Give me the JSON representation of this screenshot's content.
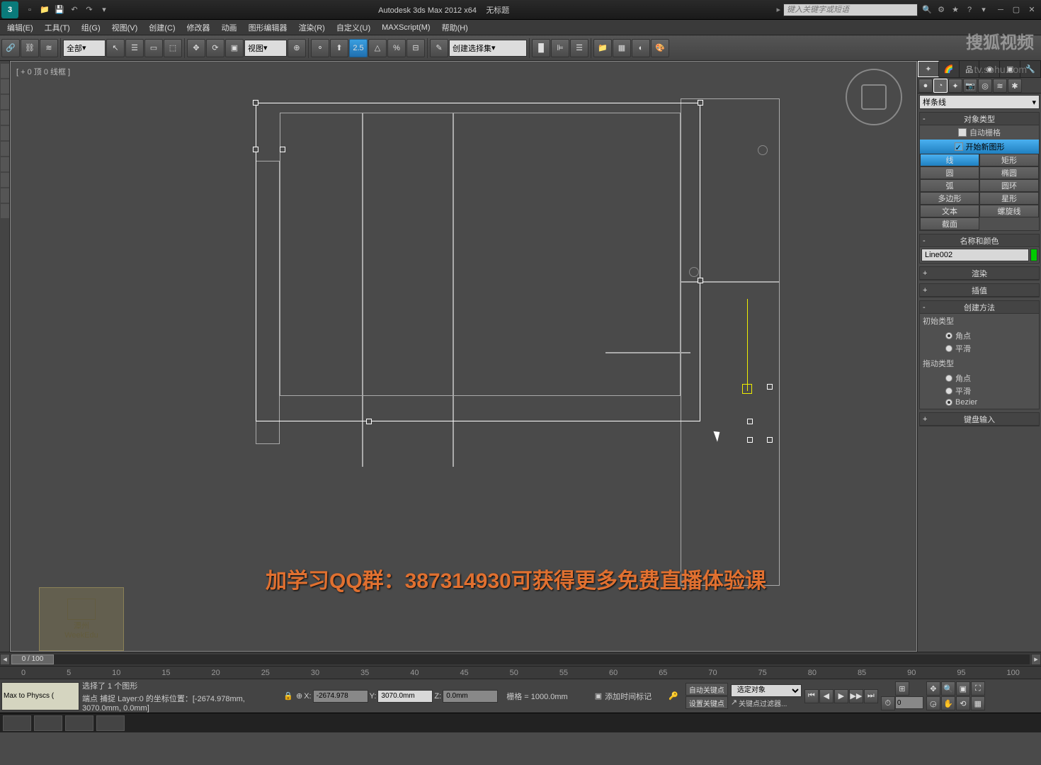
{
  "title": "Autodesk 3ds Max  2012 x64",
  "doc": "无标题",
  "search_placeholder": "键入关键字或短语",
  "menus": [
    "编辑(E)",
    "工具(T)",
    "组(G)",
    "视图(V)",
    "创建(C)",
    "修改器",
    "动画",
    "图形编辑器",
    "渲染(R)",
    "自定义(U)",
    "MAXScript(M)",
    "帮助(H)"
  ],
  "selset_drop": "创建选择集",
  "filter_drop": "全部",
  "view_drop": "视图",
  "snap_val": "2.5",
  "vp_label": "[ + 0 顶 0 线框 ]",
  "promo": "加学习QQ群：387314930可获得更多免费直播体验课",
  "shapes_drop": "样条线",
  "panel": {
    "obj_type": "对象类型",
    "autogrid": "自动栅格",
    "start_new": "开始新图形",
    "btns": [
      [
        "线",
        "矩形"
      ],
      [
        "圆",
        "椭圆"
      ],
      [
        "弧",
        "圆环"
      ],
      [
        "多边形",
        "星形"
      ],
      [
        "文本",
        "螺旋线"
      ],
      [
        "截面",
        ""
      ]
    ],
    "name_color": "名称和颜色",
    "obj_name": "Line002",
    "render": "渲染",
    "interp": "插值",
    "create_method": "创建方法",
    "init_type": "初始类型",
    "drag_type": "拖动类型",
    "corner": "角点",
    "smooth": "平滑",
    "bezier": "Bezier",
    "keyboard": "键盘输入"
  },
  "slider": "0 / 100",
  "ruler_ticks": [
    "0",
    "5",
    "10",
    "15",
    "20",
    "25",
    "30",
    "35",
    "40",
    "45",
    "50",
    "55",
    "60",
    "65",
    "70",
    "75",
    "80",
    "85",
    "90",
    "95",
    "100"
  ],
  "status": {
    "script": "Max to Physcs (",
    "sel": "选择了 1 个图形",
    "snap": "端点 捕捉 Layer:0 的坐标位置：[-2674.978mm, 3070.0mm, 0.0mm]",
    "x": "-2674.978",
    "y": "3070.0mm",
    "z": "0.0mm",
    "grid": "栅格 = 1000.0mm",
    "autokey": "自动关键点",
    "setkey": "设置关键点",
    "selobj": "选定对象",
    "keyfilter": "关键点过滤器...",
    "timetag": "添加时间标记",
    "frame": "0"
  },
  "watermark": {
    "l1": "潭州",
    "l2": "WeekEdu"
  },
  "sohu": "搜狐视频",
  "sohu_url": "tv.sohu.com"
}
